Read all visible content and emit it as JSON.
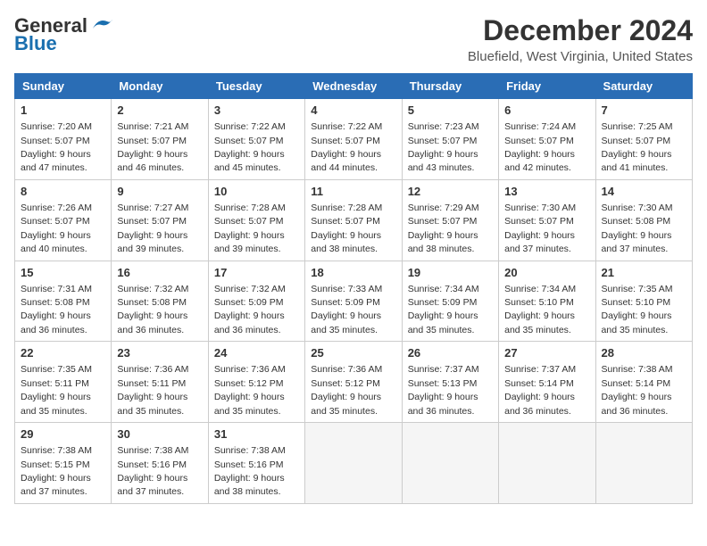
{
  "logo": {
    "line1": "General",
    "line2": "Blue"
  },
  "title": "December 2024",
  "location": "Bluefield, West Virginia, United States",
  "days_of_week": [
    "Sunday",
    "Monday",
    "Tuesday",
    "Wednesday",
    "Thursday",
    "Friday",
    "Saturday"
  ],
  "weeks": [
    [
      {
        "day": 1,
        "sunrise": "7:20 AM",
        "sunset": "5:07 PM",
        "daylight": "9 hours and 47 minutes."
      },
      {
        "day": 2,
        "sunrise": "7:21 AM",
        "sunset": "5:07 PM",
        "daylight": "9 hours and 46 minutes."
      },
      {
        "day": 3,
        "sunrise": "7:22 AM",
        "sunset": "5:07 PM",
        "daylight": "9 hours and 45 minutes."
      },
      {
        "day": 4,
        "sunrise": "7:22 AM",
        "sunset": "5:07 PM",
        "daylight": "9 hours and 44 minutes."
      },
      {
        "day": 5,
        "sunrise": "7:23 AM",
        "sunset": "5:07 PM",
        "daylight": "9 hours and 43 minutes."
      },
      {
        "day": 6,
        "sunrise": "7:24 AM",
        "sunset": "5:07 PM",
        "daylight": "9 hours and 42 minutes."
      },
      {
        "day": 7,
        "sunrise": "7:25 AM",
        "sunset": "5:07 PM",
        "daylight": "9 hours and 41 minutes."
      }
    ],
    [
      {
        "day": 8,
        "sunrise": "7:26 AM",
        "sunset": "5:07 PM",
        "daylight": "9 hours and 40 minutes."
      },
      {
        "day": 9,
        "sunrise": "7:27 AM",
        "sunset": "5:07 PM",
        "daylight": "9 hours and 39 minutes."
      },
      {
        "day": 10,
        "sunrise": "7:28 AM",
        "sunset": "5:07 PM",
        "daylight": "9 hours and 39 minutes."
      },
      {
        "day": 11,
        "sunrise": "7:28 AM",
        "sunset": "5:07 PM",
        "daylight": "9 hours and 38 minutes."
      },
      {
        "day": 12,
        "sunrise": "7:29 AM",
        "sunset": "5:07 PM",
        "daylight": "9 hours and 38 minutes."
      },
      {
        "day": 13,
        "sunrise": "7:30 AM",
        "sunset": "5:07 PM",
        "daylight": "9 hours and 37 minutes."
      },
      {
        "day": 14,
        "sunrise": "7:30 AM",
        "sunset": "5:08 PM",
        "daylight": "9 hours and 37 minutes."
      }
    ],
    [
      {
        "day": 15,
        "sunrise": "7:31 AM",
        "sunset": "5:08 PM",
        "daylight": "9 hours and 36 minutes."
      },
      {
        "day": 16,
        "sunrise": "7:32 AM",
        "sunset": "5:08 PM",
        "daylight": "9 hours and 36 minutes."
      },
      {
        "day": 17,
        "sunrise": "7:32 AM",
        "sunset": "5:09 PM",
        "daylight": "9 hours and 36 minutes."
      },
      {
        "day": 18,
        "sunrise": "7:33 AM",
        "sunset": "5:09 PM",
        "daylight": "9 hours and 35 minutes."
      },
      {
        "day": 19,
        "sunrise": "7:34 AM",
        "sunset": "5:09 PM",
        "daylight": "9 hours and 35 minutes."
      },
      {
        "day": 20,
        "sunrise": "7:34 AM",
        "sunset": "5:10 PM",
        "daylight": "9 hours and 35 minutes."
      },
      {
        "day": 21,
        "sunrise": "7:35 AM",
        "sunset": "5:10 PM",
        "daylight": "9 hours and 35 minutes."
      }
    ],
    [
      {
        "day": 22,
        "sunrise": "7:35 AM",
        "sunset": "5:11 PM",
        "daylight": "9 hours and 35 minutes."
      },
      {
        "day": 23,
        "sunrise": "7:36 AM",
        "sunset": "5:11 PM",
        "daylight": "9 hours and 35 minutes."
      },
      {
        "day": 24,
        "sunrise": "7:36 AM",
        "sunset": "5:12 PM",
        "daylight": "9 hours and 35 minutes."
      },
      {
        "day": 25,
        "sunrise": "7:36 AM",
        "sunset": "5:12 PM",
        "daylight": "9 hours and 35 minutes."
      },
      {
        "day": 26,
        "sunrise": "7:37 AM",
        "sunset": "5:13 PM",
        "daylight": "9 hours and 36 minutes."
      },
      {
        "day": 27,
        "sunrise": "7:37 AM",
        "sunset": "5:14 PM",
        "daylight": "9 hours and 36 minutes."
      },
      {
        "day": 28,
        "sunrise": "7:38 AM",
        "sunset": "5:14 PM",
        "daylight": "9 hours and 36 minutes."
      }
    ],
    [
      {
        "day": 29,
        "sunrise": "7:38 AM",
        "sunset": "5:15 PM",
        "daylight": "9 hours and 37 minutes."
      },
      {
        "day": 30,
        "sunrise": "7:38 AM",
        "sunset": "5:16 PM",
        "daylight": "9 hours and 37 minutes."
      },
      {
        "day": 31,
        "sunrise": "7:38 AM",
        "sunset": "5:16 PM",
        "daylight": "9 hours and 38 minutes."
      },
      null,
      null,
      null,
      null
    ]
  ]
}
